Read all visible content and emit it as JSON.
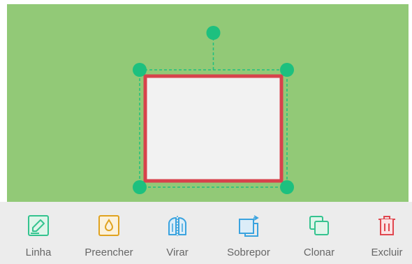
{
  "colors": {
    "canvas_background": "#92c977",
    "shape_fill": "#f2f2f2",
    "shape_stroke": "#d8424c",
    "selection_handle": "#1dc07f",
    "toolbar_background": "#ececec",
    "toolbar_label": "#666666"
  },
  "toolbar": {
    "items": [
      {
        "id": "line",
        "label": "Linha",
        "icon": "pencil-square-icon",
        "color": "#34c38f"
      },
      {
        "id": "fill",
        "label": "Preencher",
        "icon": "droplet-icon",
        "color": "#e0a21f"
      },
      {
        "id": "flip",
        "label": "Virar",
        "icon": "flip-icon",
        "color": "#3aa3df"
      },
      {
        "id": "overlay",
        "label": "Sobrepor",
        "icon": "layer-order-icon",
        "color": "#3aa3df"
      },
      {
        "id": "clone",
        "label": "Clonar",
        "icon": "clone-icon",
        "color": "#34c38f"
      },
      {
        "id": "delete",
        "label": "Excluir",
        "icon": "trash-icon",
        "color": "#e0474f"
      }
    ]
  }
}
